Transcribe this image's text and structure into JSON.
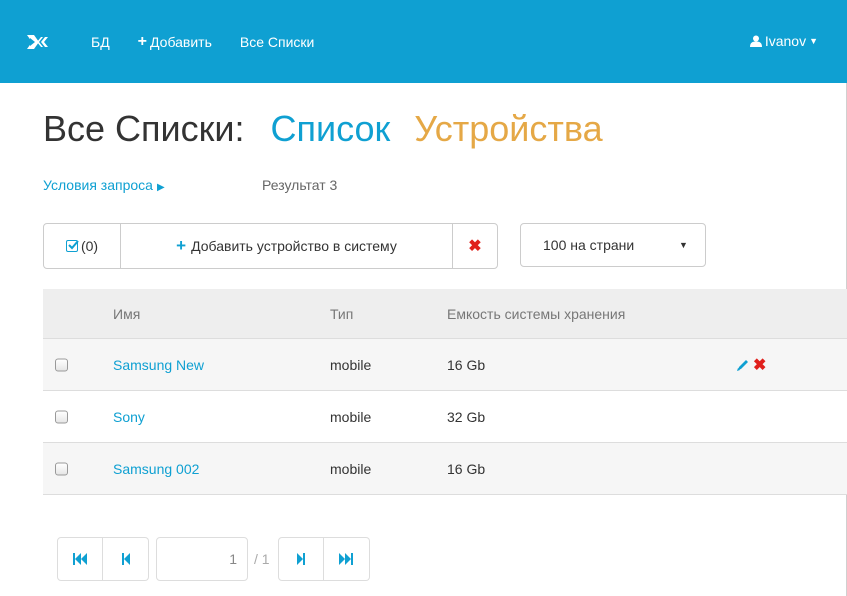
{
  "navbar": {
    "brand_icon": "logo-icon",
    "items": [
      {
        "label": "БД"
      },
      {
        "label": "Добавить",
        "icon": "plus-icon"
      },
      {
        "label": "Все Списки"
      }
    ],
    "user": {
      "label": "Ivanov",
      "icon": "user-icon"
    },
    "bg_color": "#0fa0d2"
  },
  "page": {
    "title_prefix": "Все Списки:",
    "title_list": "Список",
    "title_entity": "Устройства",
    "query_link": "Условия запроса",
    "result_label": "Результат 3"
  },
  "toolbar": {
    "select_count": "(0)",
    "add_label": "Добавить устройство в систему",
    "delete_icon": "close-icon",
    "per_page": "100 на страни"
  },
  "table": {
    "headers": [
      "Имя",
      "Тип",
      "Емкость системы хранения"
    ],
    "rows": [
      {
        "name": "Samsung New",
        "type": "mobile",
        "capacity": "16 Gb"
      },
      {
        "name": "Sony",
        "type": "mobile",
        "capacity": "32 Gb"
      },
      {
        "name": "Samsung 002",
        "type": "mobile",
        "capacity": "16 Gb"
      }
    ]
  },
  "pagination": {
    "current": "1",
    "total": "/ 1"
  },
  "colors": {
    "accent": "#0fa0d2",
    "orange": "#e5a846",
    "danger": "#e0201c"
  }
}
